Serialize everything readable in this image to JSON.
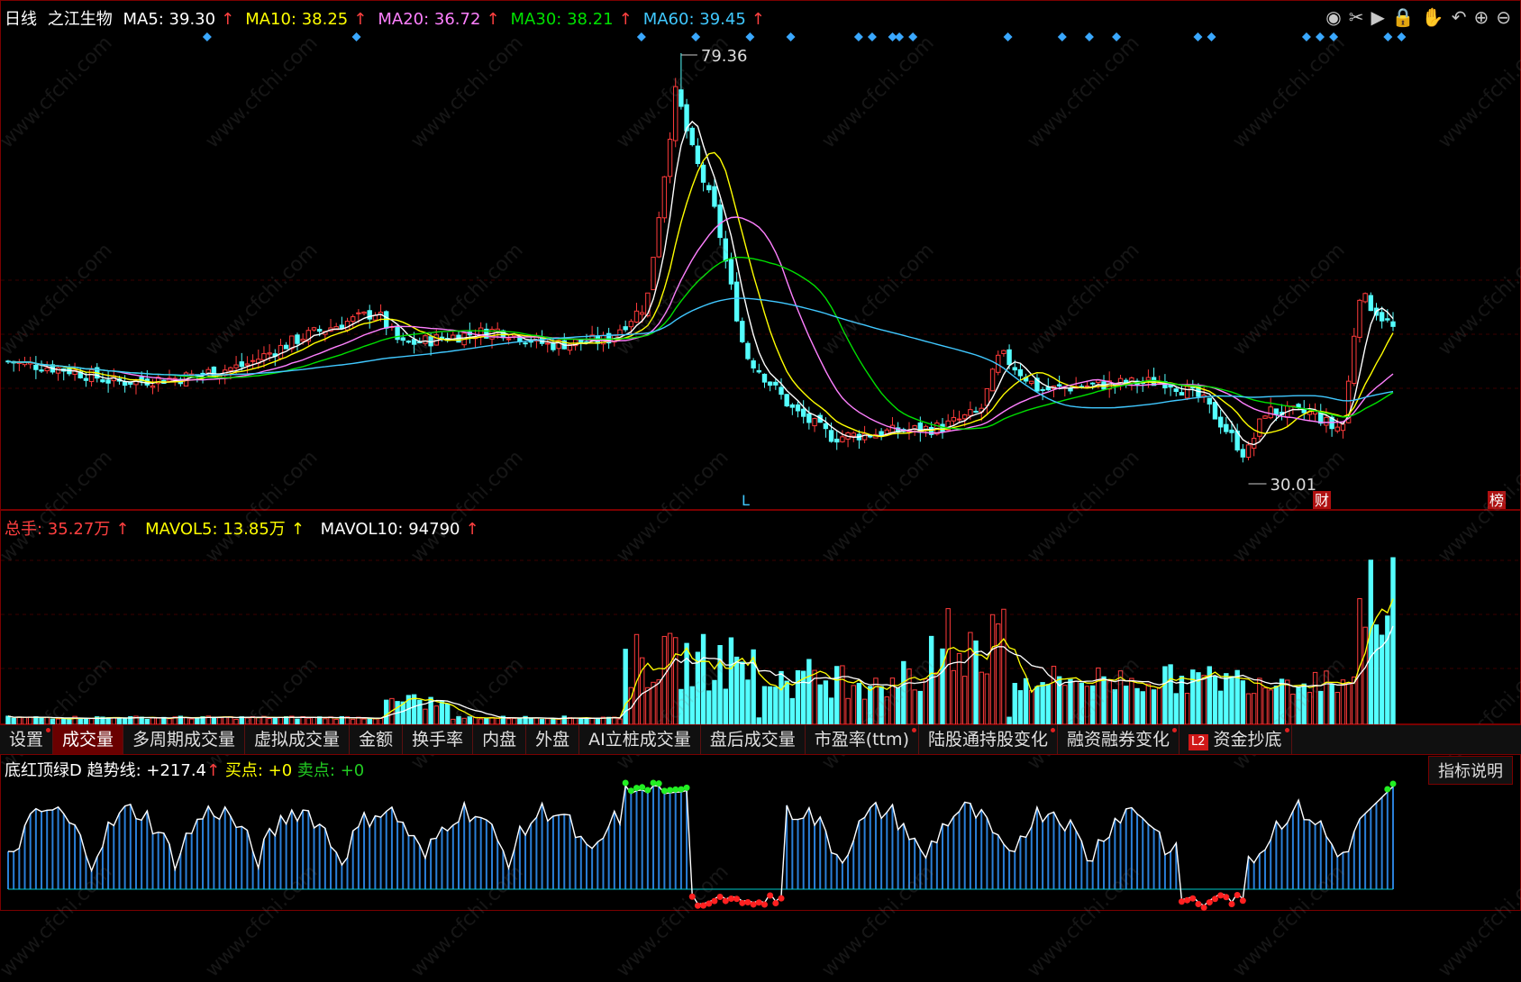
{
  "header": {
    "period": "日线",
    "stock_name": "之江生物",
    "ma": [
      {
        "label": "MA5: 39.30",
        "color": "#ffffff"
      },
      {
        "label": "MA10: 38.25",
        "color": "#ffff00"
      },
      {
        "label": "MA20: 36.72",
        "color": "#ff80ff"
      },
      {
        "label": "MA30: 38.21",
        "color": "#00e000"
      },
      {
        "label": "MA60: 39.45",
        "color": "#40c8ff"
      }
    ],
    "arrow": "↑"
  },
  "toolbar": {
    "icons": [
      "eye-icon",
      "scissors-icon",
      "play-icon",
      "lock-icon",
      "hand-icon",
      "undo-icon",
      "zoom-in-icon",
      "zoom-out-icon"
    ],
    "glyphs": [
      "◉",
      "✂",
      "▶",
      "🔒",
      "✋",
      "↶",
      "⊕",
      "⊖"
    ]
  },
  "annotations": {
    "high_label": "79.36",
    "low_label": "30.01",
    "marker_L": "L",
    "marker_cai": "财",
    "marker_bang": "榜"
  },
  "volume_header": {
    "total": "总手: 35.27万",
    "mavol5": "MAVOL5: 13.85万",
    "mavol10": "MAVOL10: 94790",
    "arrow": "↑"
  },
  "tabs": [
    {
      "label": "设置",
      "dot": true
    },
    {
      "label": "成交量",
      "active": true
    },
    {
      "label": "多周期成交量"
    },
    {
      "label": "虚拟成交量"
    },
    {
      "label": "金额"
    },
    {
      "label": "换手率"
    },
    {
      "label": "内盘"
    },
    {
      "label": "外盘"
    },
    {
      "label": "AI立桩成交量"
    },
    {
      "label": "盘后成交量"
    },
    {
      "label": "市盈率(ttm)",
      "dot": true
    },
    {
      "label": "陆股通持股变化",
      "dot": true
    },
    {
      "label": "融资融券变化",
      "dot": true
    },
    {
      "label": "资金抄底",
      "l2": "L2",
      "dot": true
    }
  ],
  "indicator": {
    "name": "底红顶绿D",
    "trend": "趋势线: +217.4",
    "arrow": "↑",
    "buy": "买点: +0",
    "sell": "卖点: +0",
    "help": "指标说明"
  },
  "watermark": "www.cfchi.com",
  "colors": {
    "up": "#ff3b3b",
    "down": "#54ffff",
    "ma5": "#ffffff",
    "ma10": "#ffff00",
    "ma20": "#ff80ff",
    "ma30": "#00e000",
    "ma60": "#40c8ff",
    "diamond": "#3aa8ff",
    "indbar": "#2a7fd8",
    "indline": "#ffffff",
    "red_dot": "#ff2020",
    "green_dot": "#22ee22"
  },
  "chart_data": {
    "type": "candlestick",
    "price_high": 79.36,
    "price_low": 30.01,
    "series": [
      {
        "name": "MA5",
        "value": 39.3
      },
      {
        "name": "MA10",
        "value": 38.25
      },
      {
        "name": "MA20",
        "value": 36.72
      },
      {
        "name": "MA30",
        "value": 38.21
      },
      {
        "name": "MA60",
        "value": 39.45
      }
    ],
    "volume": {
      "total": "35.27万",
      "mavol5": "13.85万",
      "mavol10": 94790
    },
    "indicator": {
      "trend": 217.4,
      "buy": 0,
      "sell": 0
    }
  }
}
